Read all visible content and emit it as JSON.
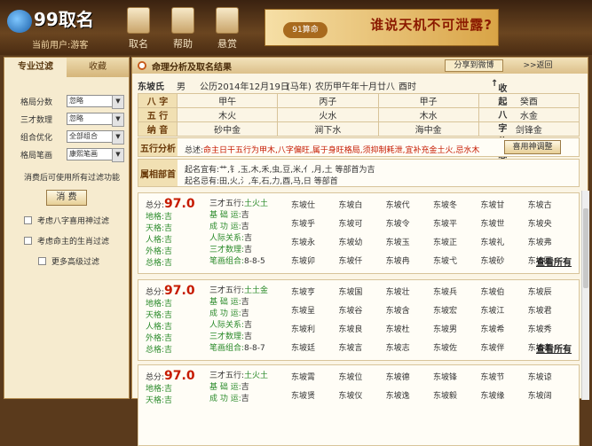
{
  "app": {
    "logo_text": "99取名",
    "user_line": "当前用户:游客"
  },
  "topnav": [
    {
      "label": "取名"
    },
    {
      "label": "帮助"
    },
    {
      "label": "悬赏"
    }
  ],
  "banner": {
    "text": "谁说天机不可泄露?",
    "badge": "91算命"
  },
  "left": {
    "tabs": [
      {
        "label": "专业过滤"
      },
      {
        "label": "收藏"
      }
    ],
    "filters": [
      {
        "label": "格局分数",
        "value": "忽略"
      },
      {
        "label": "三才数理",
        "value": "忽略"
      },
      {
        "label": "组合优化",
        "value": "全部组合"
      },
      {
        "label": "格局笔画",
        "value": "康熙笔画"
      }
    ],
    "note": "消费后可使用所有过滤功能",
    "consume_button": "消 费",
    "checks": [
      {
        "label": "考虑八字喜用神过滤"
      },
      {
        "label": "考虑命主的生肖过滤"
      },
      {
        "label": "更多高级过滤"
      }
    ]
  },
  "main": {
    "title": "命理分析及取名结果",
    "share_button": "分享到微博",
    "back_button": ">>返回",
    "person": {
      "surname": "东坡氏",
      "sex": "男",
      "solar": "公历2014年12月19日",
      "zodiac": "(马年)",
      "lunar": "农历甲午年十月廿八",
      "hour": "酉时",
      "collapse": "收起八字信息"
    },
    "bazi": {
      "rows": [
        {
          "head": "八 字",
          "cells": [
            "甲午",
            "丙子",
            "甲子",
            "癸酉"
          ]
        },
        {
          "head": "五 行",
          "cells": [
            "木火",
            "火水",
            "木水",
            "水金"
          ]
        },
        {
          "head": "纳 音",
          "cells": [
            "砂中金",
            "涧下水",
            "海中金",
            "剑锋金"
          ]
        }
      ]
    },
    "analysis": {
      "head": "五行分析",
      "label": "总述:",
      "text": "命主日干五行为甲木,八字偏旺,属于身旺格局,须抑制耗泄,宜补充金土火,忌水木",
      "button": "喜用神调整"
    },
    "radical": {
      "head": "属相部首",
      "line1": "起名宜有:艹,钅,玉,木,禾,虫,豆,米,亻,月,土 等部首为吉",
      "line2": "起名忌有:田,火,氵,车,石,力,酉,马,日 等部首"
    },
    "cards": [
      {
        "score_label": "总分:",
        "score": "97.0",
        "lines": [
          "地格:吉",
          "天格:吉",
          "人格:吉",
          "外格:吉",
          "总格:吉"
        ],
        "wuxing_label": "三才五行:",
        "wuxing": "土火土",
        "meta": [
          [
            "基 础 运:",
            "吉"
          ],
          [
            "成 功 运:",
            "吉"
          ],
          [
            "人际关系:",
            "吉"
          ],
          [
            "三才数理:",
            "吉"
          ],
          [
            "笔画组合:",
            "8-8-5"
          ]
        ],
        "names": [
          "东坡仕",
          "东坡白",
          "东坡代",
          "东坡冬",
          "东坡甘",
          "东坡古",
          "东坡乎",
          "东坡可",
          "东坡令",
          "东坡平",
          "东坡世",
          "东坡央",
          "东坡永",
          "东坡幼",
          "东坡玉",
          "东坡正",
          "东坡礼",
          "东坡弗",
          "东坡卯",
          "东坡仟",
          "东坡冉",
          "东坡弋",
          "东坡砂",
          "东坡匝"
        ],
        "all": "查看所有"
      },
      {
        "score_label": "总分:",
        "score": "97.0",
        "lines": [
          "地格:吉",
          "天格:吉",
          "人格:吉",
          "外格:吉",
          "总格:吉"
        ],
        "wuxing_label": "三才五行:",
        "wuxing": "土土金",
        "meta": [
          [
            "基 础 运:",
            "吉"
          ],
          [
            "成 功 运:",
            "吉"
          ],
          [
            "人际关系:",
            "吉"
          ],
          [
            "三才数理:",
            "吉"
          ],
          [
            "笔画组合:",
            "8-8-7"
          ]
        ],
        "names": [
          "东坡亨",
          "东坡国",
          "东坡壮",
          "东坡兵",
          "东坡伯",
          "东坡辰",
          "东坡呈",
          "东坡谷",
          "东坡含",
          "东坡宏",
          "东坡江",
          "东坡君",
          "东坡利",
          "东坡良",
          "东坡杜",
          "东坡男",
          "东坡希",
          "东坡秀",
          "东坡廷",
          "东坡言",
          "东坡志",
          "东坡佐",
          "东坡伴",
          "东坡孝"
        ],
        "all": "查看所有"
      },
      {
        "score_label": "总分:",
        "score": "97.0",
        "lines": [
          "地格:吉",
          "天格:吉"
        ],
        "wuxing_label": "三才五行:",
        "wuxing": "土火土",
        "meta": [
          [
            "基 础 运:",
            "吉"
          ],
          [
            "成 功 运:",
            "吉"
          ]
        ],
        "names": [
          "东坡霄",
          "东坡位",
          "东坡德",
          "东坡锋",
          "东坡节",
          "东坡谅",
          "东坡贤",
          "东坡仪",
          "东坡逸",
          "东坡毅",
          "东坡缘",
          "东坡阔"
        ],
        "all": ""
      }
    ]
  }
}
